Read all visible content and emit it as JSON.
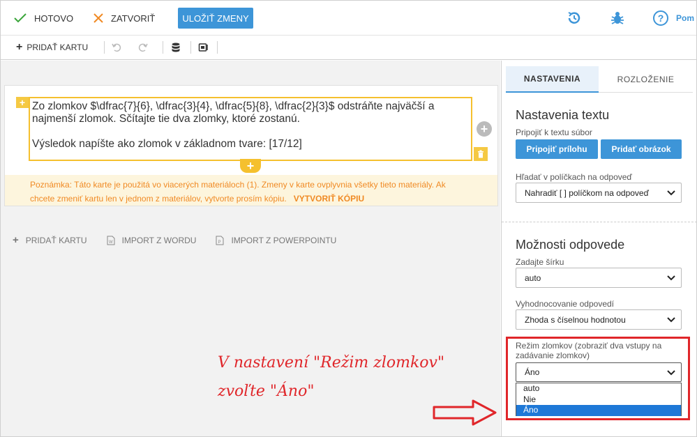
{
  "toolbar": {
    "done_label": "HOTOVO",
    "close_label": "ZATVORIŤ",
    "save_label": "ULOŽIŤ ZMENY",
    "help_label": "Pom"
  },
  "toolbar2": {
    "add_card_label": "PRIDAŤ KARTU"
  },
  "card": {
    "line1": "Zo zlomkov $\\dfrac{7}{6}, \\dfrac{3}{4}, \\dfrac{5}{8}, \\dfrac{2}{3}$ odstráňte najväčší a",
    "line2": "najmenší zlomok. Sčítajte tie dva zlomky, ktoré zostanú.",
    "line3": "Výsledok napíšte ako zlomok v základnom tvare: [17/12]",
    "note_line1": "Poznámka: Táto karte je použitá vo viacerých materiáloch (1). Zmeny v karte ovplyvnia všetky tieto materiály. Ak",
    "note_line2": "chcete zmeniť kartu len v jednom z materiálov, vytvorte prosím kópiu.",
    "copy_link": "VYTVORIŤ KÓPIU"
  },
  "bottom_links": {
    "add_card": "PRIDAŤ KARTU",
    "import_word": "IMPORT Z WORDU",
    "import_ppt": "IMPORT Z POWERPOINTU"
  },
  "annotation": {
    "line1": "V nastavení \"Režim zlomkov\"",
    "line2": "zvoľte \"Áno\""
  },
  "panel": {
    "tab_settings": "NASTAVENIA",
    "tab_layout": "ROZLOŽENIE",
    "text_settings_title": "Nastavenia textu",
    "attach_label": "Pripojiť k textu súbor",
    "attach_button": "Pripojiť prílohu",
    "add_image_button": "Pridať obrázok",
    "search_label": "Hľadať v políčkach na odpoveď",
    "search_value": "Nahradiť [ ] políčkom na odpoveď",
    "answer_options_title": "Možnosti odpovede",
    "width_label": "Zadajte šírku",
    "width_value": "auto",
    "eval_label": "Vyhodnocovanie odpovedí",
    "eval_value": "Zhoda s číselnou hodnotou",
    "fraction_label_1": "Režim zlomkov (zobraziť dva vstupy na",
    "fraction_label_2": "zadávanie zlomkov)",
    "fraction_value": "Áno",
    "fraction_options": [
      "auto",
      "Nie",
      "Áno"
    ]
  },
  "colors": {
    "accent": "#3d95d8",
    "highlight": "#f5c02e",
    "annotation": "#e0262a"
  }
}
